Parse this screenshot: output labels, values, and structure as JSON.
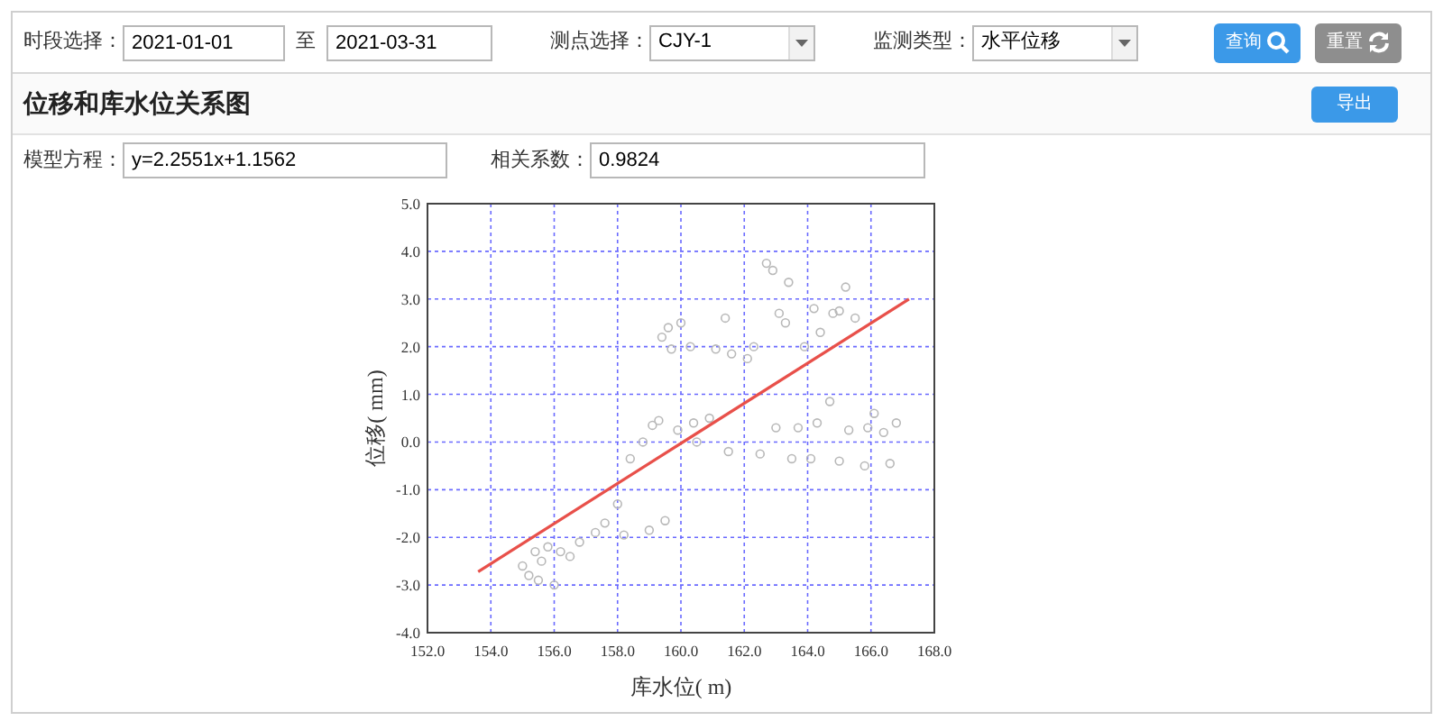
{
  "filters": {
    "date_label": "时段选择：",
    "date_from": "2021-01-01",
    "date_sep": "至",
    "date_to": "2021-03-31",
    "point_label": "测点选择：",
    "point_value": "CJY-1",
    "type_label": "监测类型：",
    "type_value": "水平位移"
  },
  "buttons": [
    {
      "label": "查询",
      "kind": "search"
    },
    {
      "label": "重置",
      "kind": "reset"
    }
  ],
  "panel": {
    "title": "位移和库水位关系图",
    "export_button": "导出",
    "model_label": "模型方程：",
    "model_value": "y=2.2551x+1.1562",
    "corr_label": "相关系数：",
    "corr_value": "0.9824",
    "chart_data": {
      "type": "scatter",
      "xlabel": "库水位( m)",
      "ylabel": "位移( mm)",
      "grid": true,
      "xlim": [
        152,
        168
      ],
      "ylim": [
        -4,
        5
      ],
      "xticks": [
        {
          "value": 152,
          "label": "152.0"
        },
        {
          "value": 154,
          "label": "154.0"
        },
        {
          "value": 156,
          "label": "156.0"
        },
        {
          "value": 158,
          "label": "158.0"
        },
        {
          "value": 160,
          "label": "160.0"
        },
        {
          "value": 162,
          "label": "162.0"
        },
        {
          "value": 164,
          "label": "164.0"
        },
        {
          "value": 166,
          "label": "166.0"
        },
        {
          "value": 168,
          "label": "168.0"
        }
      ],
      "yticks": [
        {
          "value": -4,
          "label": "-4.0"
        },
        {
          "value": -3,
          "label": "-3.0"
        },
        {
          "value": -2,
          "label": "-2.0"
        },
        {
          "value": -1,
          "label": "-1.0"
        },
        {
          "value": 0,
          "label": "0.0"
        },
        {
          "value": 1,
          "label": "1.0"
        },
        {
          "value": 2,
          "label": "2.0"
        },
        {
          "value": 3,
          "label": "3.0"
        },
        {
          "value": 4,
          "label": "4.0"
        },
        {
          "value": 5,
          "label": "5.0"
        }
      ],
      "series": [
        {
          "color": "#b8b8b8",
          "x": [
            155,
            155.2,
            155.4,
            155.5,
            155.6,
            155.8,
            156,
            156.2,
            156.5,
            156.8,
            157.3,
            157.6,
            158,
            158.2,
            158.4,
            158.8,
            159,
            159.1,
            159.3,
            159.5,
            159.4,
            159.6,
            159.7,
            159.9,
            160,
            160.3,
            160.4,
            160.5,
            160.9,
            161.1,
            161.4,
            161.5,
            161.6,
            162.1,
            162.3,
            162.5,
            162.7,
            162.9,
            163,
            163.3,
            163.4,
            163.5,
            163.7,
            163.9,
            164.1,
            164.2,
            164.3,
            164.4,
            164.7,
            165,
            165,
            165.2,
            165.3,
            165.5,
            165.8,
            165.9,
            166.1,
            166.4,
            166.6,
            166.8,
            163.1,
            164.8
          ],
          "values": [
            -2.6,
            -2.8,
            -2.3,
            -2.9,
            -2.5,
            -2.2,
            -3,
            -2.3,
            -2.4,
            -2.1,
            -1.9,
            -1.7,
            -1.3,
            -1.95,
            -0.35,
            0,
            -1.85,
            0.35,
            0.45,
            -1.65,
            2.2,
            2.4,
            1.95,
            0.25,
            2.5,
            2,
            0.4,
            0,
            0.5,
            1.95,
            2.6,
            -0.2,
            1.85,
            1.75,
            2,
            -0.25,
            3.75,
            3.6,
            0.3,
            2.5,
            3.35,
            -0.35,
            0.3,
            2,
            -0.35,
            2.8,
            0.4,
            2.3,
            0.85,
            2.75,
            -0.4,
            3.25,
            0.25,
            2.6,
            -0.5,
            0.3,
            0.6,
            0.2,
            -0.45,
            0.4,
            2.7,
            2.7
          ]
        },
        {
          "type": "line",
          "color": "#e8504a",
          "x": [
            153.6,
            167.2
          ],
          "values": [
            -2.72,
            3
          ]
        }
      ]
    }
  }
}
